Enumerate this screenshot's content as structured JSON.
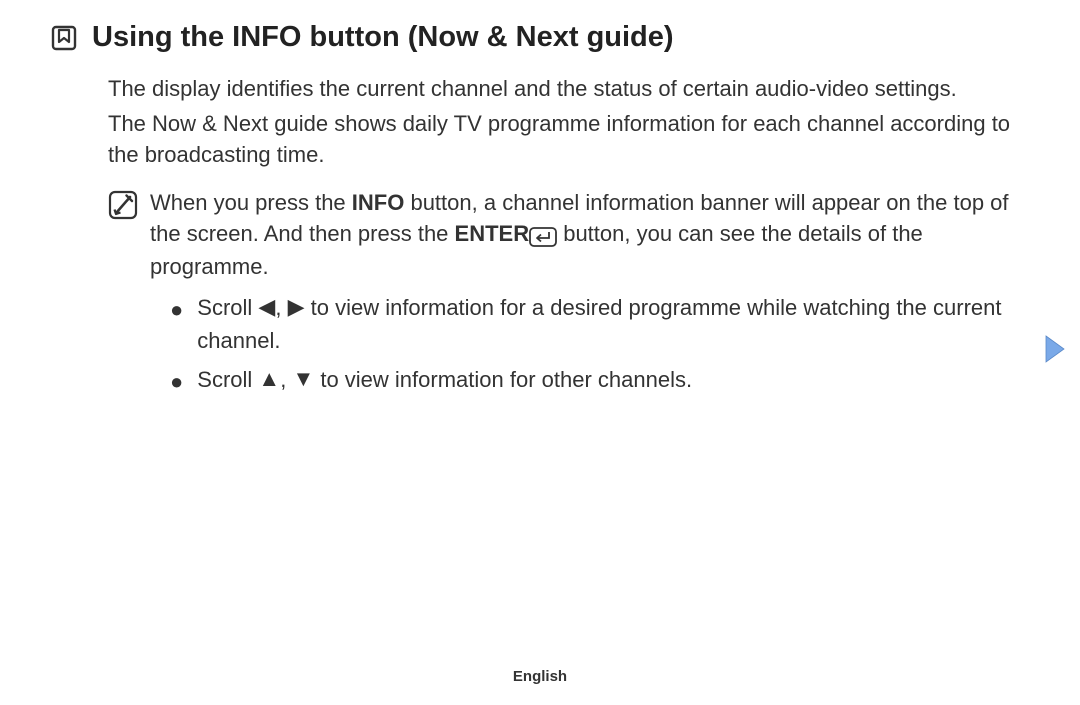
{
  "title": "Using the INFO button (Now & Next guide)",
  "para1": "The display identifies the current channel and the status of certain audio-video settings.",
  "para2": "The Now & Next guide shows daily TV programme information for each channel according to the broadcasting time.",
  "note": {
    "pre": "When you press the ",
    "info_label": "INFO",
    "mid1": " button, a channel information banner will appear on the top of the screen. And then press the ",
    "enter_label": "ENTER",
    "post": " button, you can see the details of the programme."
  },
  "bullet1": {
    "pre": "Scroll ",
    "post": " to view information for a desired programme while watching the current channel."
  },
  "bullet2": {
    "pre": "Scroll ",
    "post": " to view information for other channels."
  },
  "glyphs": {
    "left": "◀",
    "right": "▶",
    "up": "▲",
    "down": "▼",
    "comma": ", "
  },
  "footer": "English"
}
